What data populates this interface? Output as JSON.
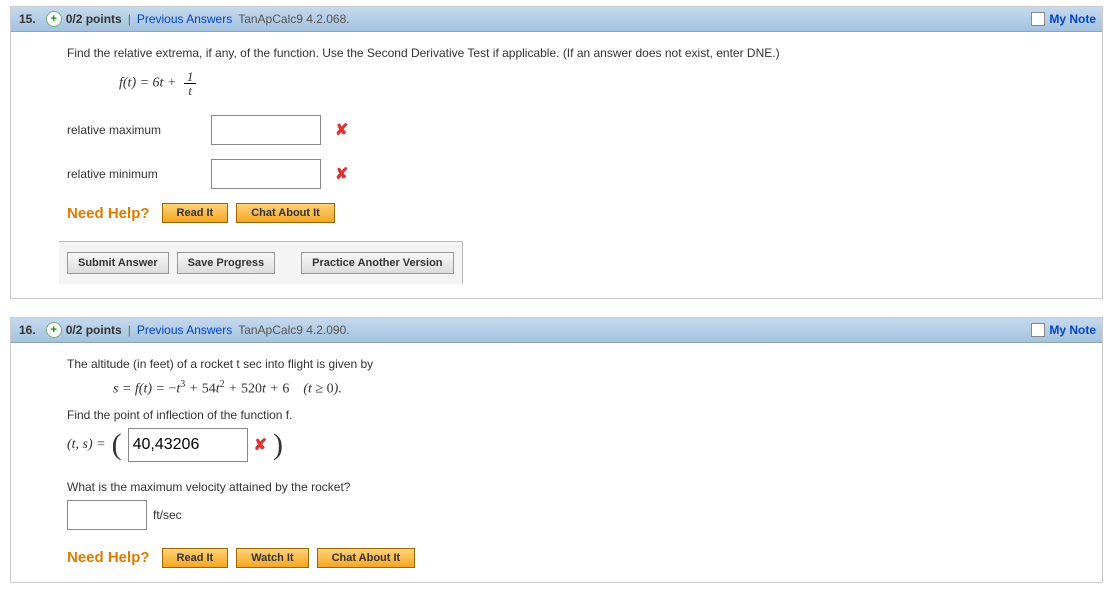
{
  "q15": {
    "number": "15.",
    "points": "0/2 points",
    "prev": "Previous Answers",
    "source": "TanApCalc9 4.2.068.",
    "mynotes": "My Note",
    "prompt": "Find the relative extrema, if any, of the function. Use the Second Derivative Test if applicable. (If an answer does not exist, enter DNE.)",
    "formula_lhs": "f(t) = 6t + ",
    "frac_num": "1",
    "frac_den": "t",
    "labels": {
      "max": "relative maximum",
      "min": "relative minimum"
    },
    "needhelp": "Need Help?",
    "help": {
      "read": "Read It",
      "chat": "Chat About It"
    },
    "buttons": {
      "submit": "Submit Answer",
      "save": "Save Progress",
      "practice": "Practice Another Version"
    }
  },
  "q16": {
    "number": "16.",
    "points": "0/2 points",
    "prev": "Previous Answers",
    "source": "TanApCalc9 4.2.090.",
    "mynotes": "My Note",
    "prompt": "The altitude (in feet) of a rocket t sec into flight is given by",
    "formula": "s = f(t) = −t³ + 54t² + 520t + 6  (t ≥ 0).",
    "sub1": "Find the point of inflection of the function f.",
    "ts_label": "(t, s) = ",
    "answer1": "40,43206",
    "sub2": "What is the maximum velocity attained by the rocket?",
    "unit": "ft/sec",
    "needhelp": "Need Help?",
    "help": {
      "read": "Read It",
      "watch": "Watch It",
      "chat": "Chat About It"
    }
  }
}
